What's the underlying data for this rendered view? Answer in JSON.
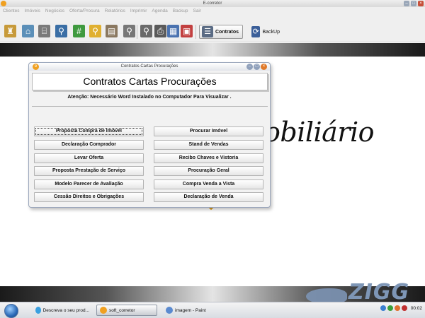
{
  "window": {
    "title": "E-corretor"
  },
  "menu": [
    "Clientes",
    "Imóveis",
    "Negócios",
    "Oferta/Procura",
    "Relatórios",
    "Imprimir",
    "Agenda",
    "Backup",
    "Sair"
  ],
  "toolbar": {
    "contratos_label": "Contratos",
    "backup_label": "BackUp"
  },
  "background": {
    "logo_text": "obiliário"
  },
  "dialog": {
    "title": "Contratos Cartas Procurações",
    "heading": "Contratos Cartas Procurações",
    "notice": "Atenção: Necessário Word Instalado no Computador Para Visualizar .",
    "buttons_left": [
      "Proposta Compra de Imóvel",
      "Declaração Comprador",
      "Levar Oferta",
      "Proposta Prestação de Serviço",
      "Modelo Parecer de Avaliação",
      "Cessão Direitos e Obrigações"
    ],
    "buttons_right": [
      "Procurar Imóvel",
      "Stand de Vendas",
      "Recibo Chaves e Vistoria",
      "Procuração Geral",
      "Compra Venda a Vista",
      "Declaração de Venda"
    ]
  },
  "taskbar": {
    "tasks": [
      "Descreva o seu prod...",
      "soft_corretor",
      "imagem - Paint"
    ],
    "clock": "00:02"
  },
  "watermark": "ZIGG",
  "colors": {
    "accent_orange": "#f0a020",
    "watermark_blue": "#7e96b6"
  }
}
